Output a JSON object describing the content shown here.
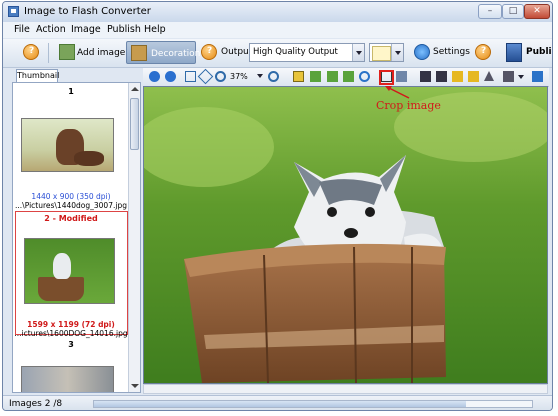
{
  "window": {
    "title": "Image to Flash Converter",
    "minimize": "–",
    "maximize": "□",
    "close": "✕"
  },
  "menu": [
    "File",
    "Action",
    "Image",
    "Publish",
    "Help"
  ],
  "toolbar": {
    "add_image": "Add image",
    "decoration": "Decoration",
    "output_label": "Output:",
    "output_value": "High Quality Output",
    "settings": "Settings",
    "publish": "Publis"
  },
  "panel": {
    "tab": "Thumbnail",
    "thumbs": [
      {
        "num": "1",
        "info": "1440 x 900 (350 dpi)",
        "path": "...\\Pictures\\1440dog_3007.jpg"
      },
      {
        "num": "2 - Modified",
        "info": "1599 x 1199 (72 dpi)",
        "path": "...ictures\\1600DOG_14016.jpg"
      },
      {
        "num": "3"
      }
    ]
  },
  "viewer_toolbar": {
    "zoom": "37%"
  },
  "annotation": "Crop image",
  "status": {
    "images": "Images 2 /8",
    "progress": 0.85
  },
  "colors": {
    "modified": "#d01a1a",
    "info": "#2a4fd6",
    "annotation": "#d01a1a"
  }
}
